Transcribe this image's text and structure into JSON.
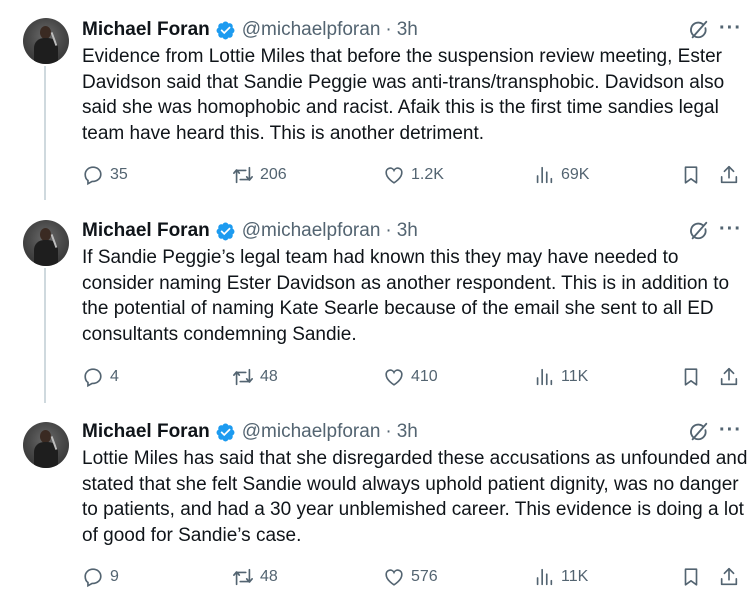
{
  "tweets": [
    {
      "name": "Michael Foran",
      "handle": "@michaelpforan",
      "separator": "·",
      "time": "3h",
      "text": "Evidence from Lottie Miles that before the suspension review meeting, Ester Davidson said that Sandie Peggie was anti-trans/transphobic. Davidson also said she was homophobic and racist. Afaik this is the first time sandies legal team have heard this. This is another detriment.",
      "replies": "35",
      "reposts": "206",
      "likes": "1.2K",
      "views": "69K"
    },
    {
      "name": "Michael Foran",
      "handle": "@michaelpforan",
      "separator": "·",
      "time": "3h",
      "text": "If Sandie Peggie’s legal team had known this they may have needed to consider naming Ester Davidson as another respondent. This is in addition to the potential of naming Kate Searle because of the email she sent to all ED consultants condemning Sandie.",
      "replies": "4",
      "reposts": "48",
      "likes": "410",
      "views": "11K"
    },
    {
      "name": "Michael Foran",
      "handle": "@michaelpforan",
      "separator": "·",
      "time": "3h",
      "text": "Lottie Miles has said that she disregarded these accusations as unfounded and stated that she felt Sandie would always uphold patient dignity, was no danger to patients, and had a 30 year unblemished career. This evidence is doing a lot of good for Sandie’s case.",
      "replies": "9",
      "reposts": "48",
      "likes": "576",
      "views": "11K"
    }
  ],
  "more_label": "···",
  "colors": {
    "verified": "#1d9bf0",
    "secondary": "#536471",
    "text": "#0f1419",
    "thread_line": "#cfd9de"
  }
}
